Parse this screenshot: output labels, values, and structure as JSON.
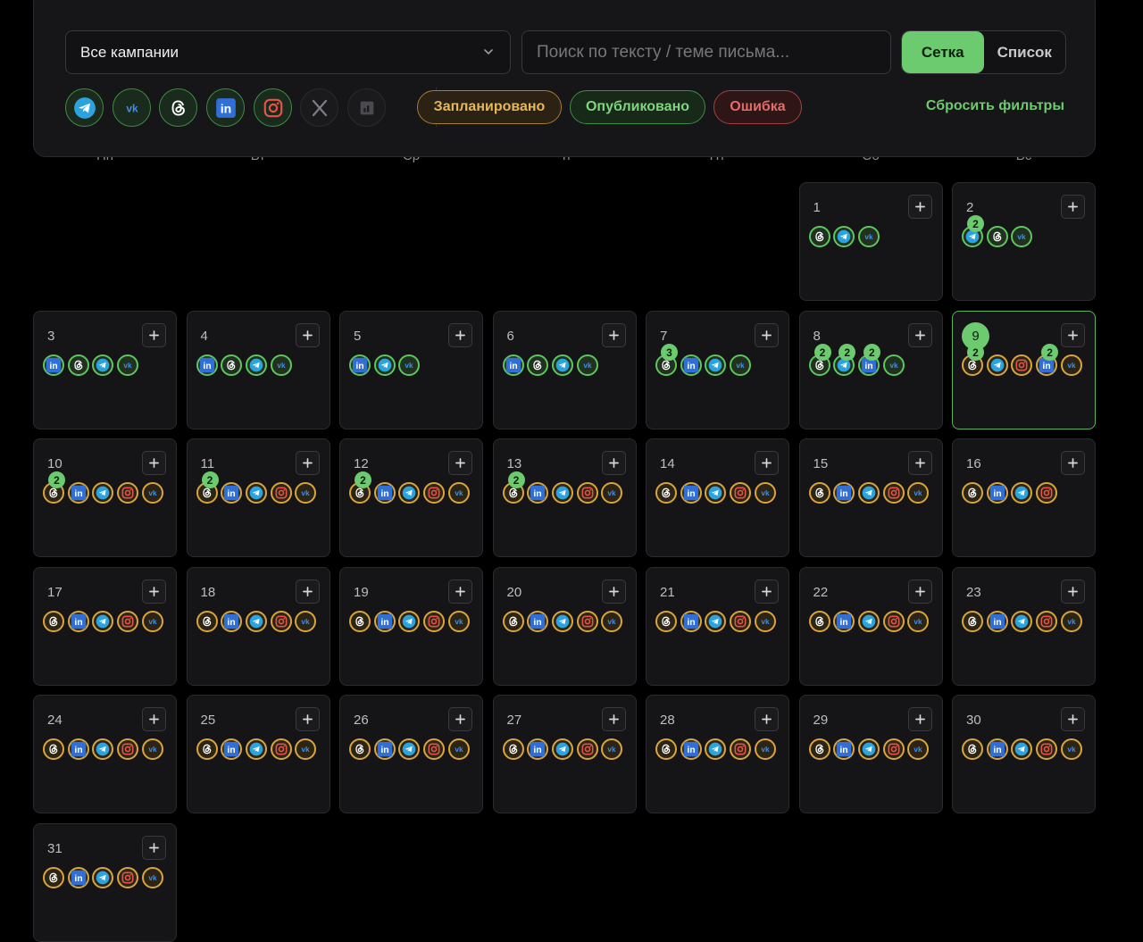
{
  "filters": {
    "campaign_select": "Все кампании",
    "search_placeholder": "Поиск по тексту / теме письма...",
    "view_grid": "Сетка",
    "view_list": "Список",
    "networks": [
      {
        "id": "telegram",
        "icon": "telegram-icon",
        "active": true
      },
      {
        "id": "vk",
        "icon": "vk-icon",
        "active": true
      },
      {
        "id": "threads",
        "icon": "threads-icon",
        "active": true
      },
      {
        "id": "linkedin",
        "icon": "linkedin-icon",
        "active": true
      },
      {
        "id": "instagram",
        "icon": "instagram-icon",
        "active": true
      },
      {
        "id": "x",
        "icon": "x-icon",
        "active": false
      },
      {
        "id": "other",
        "icon": "chart-icon",
        "active": false
      }
    ],
    "status_scheduled": "Запланировано",
    "status_published": "Опубликовано",
    "status_error": "Ошибка",
    "reset": "Сбросить фильтры"
  },
  "weekdays": [
    "Пн",
    "Вт",
    "Ср",
    "Чт",
    "Пт",
    "Сб",
    "Вс"
  ],
  "colors": {
    "published": "#5fc55f",
    "scheduled": "#d9a53d",
    "accent": "#6ccb6e"
  },
  "calendar": {
    "today": 9,
    "days": [
      {
        "d": 1,
        "posts": [
          {
            "n": "threads",
            "s": "g"
          },
          {
            "n": "telegram",
            "s": "g"
          },
          {
            "n": "vk",
            "s": "g"
          }
        ]
      },
      {
        "d": 2,
        "posts": [
          {
            "n": "telegram",
            "s": "g",
            "c": 2
          },
          {
            "n": "threads",
            "s": "g"
          },
          {
            "n": "vk",
            "s": "g"
          }
        ]
      },
      {
        "d": 3,
        "posts": [
          {
            "n": "linkedin",
            "s": "g"
          },
          {
            "n": "threads",
            "s": "g"
          },
          {
            "n": "telegram",
            "s": "g"
          },
          {
            "n": "vk",
            "s": "g"
          }
        ]
      },
      {
        "d": 4,
        "posts": [
          {
            "n": "linkedin",
            "s": "g"
          },
          {
            "n": "threads",
            "s": "g"
          },
          {
            "n": "telegram",
            "s": "g"
          },
          {
            "n": "vk",
            "s": "g"
          }
        ]
      },
      {
        "d": 5,
        "posts": [
          {
            "n": "linkedin",
            "s": "g"
          },
          {
            "n": "telegram",
            "s": "g"
          },
          {
            "n": "vk",
            "s": "g"
          }
        ]
      },
      {
        "d": 6,
        "posts": [
          {
            "n": "linkedin",
            "s": "g"
          },
          {
            "n": "threads",
            "s": "g"
          },
          {
            "n": "telegram",
            "s": "g"
          },
          {
            "n": "vk",
            "s": "g"
          }
        ]
      },
      {
        "d": 7,
        "posts": [
          {
            "n": "threads",
            "s": "g",
            "c": 3
          },
          {
            "n": "linkedin",
            "s": "g"
          },
          {
            "n": "telegram",
            "s": "g"
          },
          {
            "n": "vk",
            "s": "g"
          }
        ]
      },
      {
        "d": 8,
        "posts": [
          {
            "n": "threads",
            "s": "g",
            "c": 2
          },
          {
            "n": "telegram",
            "s": "g",
            "c": 2
          },
          {
            "n": "linkedin",
            "s": "g",
            "c": 2
          },
          {
            "n": "vk",
            "s": "g"
          }
        ]
      },
      {
        "d": 9,
        "posts": [
          {
            "n": "threads",
            "s": "o",
            "c": 2
          },
          {
            "n": "telegram",
            "s": "o"
          },
          {
            "n": "instagram",
            "s": "o"
          },
          {
            "n": "linkedin",
            "s": "o",
            "c": 2
          },
          {
            "n": "vk",
            "s": "o"
          }
        ]
      },
      {
        "d": 10,
        "posts": [
          {
            "n": "threads",
            "s": "o",
            "c": 2
          },
          {
            "n": "linkedin",
            "s": "o"
          },
          {
            "n": "telegram",
            "s": "o"
          },
          {
            "n": "instagram",
            "s": "o"
          },
          {
            "n": "vk",
            "s": "o"
          }
        ]
      },
      {
        "d": 11,
        "posts": [
          {
            "n": "threads",
            "s": "o",
            "c": 2
          },
          {
            "n": "linkedin",
            "s": "o"
          },
          {
            "n": "telegram",
            "s": "o"
          },
          {
            "n": "instagram",
            "s": "o"
          },
          {
            "n": "vk",
            "s": "o"
          }
        ]
      },
      {
        "d": 12,
        "posts": [
          {
            "n": "threads",
            "s": "o",
            "c": 2
          },
          {
            "n": "linkedin",
            "s": "o"
          },
          {
            "n": "telegram",
            "s": "o"
          },
          {
            "n": "instagram",
            "s": "o"
          },
          {
            "n": "vk",
            "s": "o"
          }
        ]
      },
      {
        "d": 13,
        "posts": [
          {
            "n": "threads",
            "s": "o",
            "c": 2
          },
          {
            "n": "linkedin",
            "s": "o"
          },
          {
            "n": "telegram",
            "s": "o"
          },
          {
            "n": "instagram",
            "s": "o"
          },
          {
            "n": "vk",
            "s": "o"
          }
        ]
      },
      {
        "d": 14,
        "posts": [
          {
            "n": "threads",
            "s": "o"
          },
          {
            "n": "linkedin",
            "s": "o"
          },
          {
            "n": "telegram",
            "s": "o"
          },
          {
            "n": "instagram",
            "s": "o"
          },
          {
            "n": "vk",
            "s": "o"
          }
        ]
      },
      {
        "d": 15,
        "posts": [
          {
            "n": "threads",
            "s": "o"
          },
          {
            "n": "linkedin",
            "s": "o"
          },
          {
            "n": "telegram",
            "s": "o"
          },
          {
            "n": "instagram",
            "s": "o"
          },
          {
            "n": "vk",
            "s": "o"
          }
        ]
      },
      {
        "d": 16,
        "posts": [
          {
            "n": "threads",
            "s": "o"
          },
          {
            "n": "linkedin",
            "s": "o"
          },
          {
            "n": "telegram",
            "s": "o"
          },
          {
            "n": "instagram",
            "s": "o"
          }
        ]
      },
      {
        "d": 17,
        "posts": [
          {
            "n": "threads",
            "s": "o"
          },
          {
            "n": "linkedin",
            "s": "o"
          },
          {
            "n": "telegram",
            "s": "o"
          },
          {
            "n": "instagram",
            "s": "o"
          },
          {
            "n": "vk",
            "s": "o"
          }
        ]
      },
      {
        "d": 18,
        "posts": [
          {
            "n": "threads",
            "s": "o"
          },
          {
            "n": "linkedin",
            "s": "o"
          },
          {
            "n": "telegram",
            "s": "o"
          },
          {
            "n": "instagram",
            "s": "o"
          },
          {
            "n": "vk",
            "s": "o"
          }
        ]
      },
      {
        "d": 19,
        "posts": [
          {
            "n": "threads",
            "s": "o"
          },
          {
            "n": "linkedin",
            "s": "o"
          },
          {
            "n": "telegram",
            "s": "o"
          },
          {
            "n": "instagram",
            "s": "o"
          },
          {
            "n": "vk",
            "s": "o"
          }
        ]
      },
      {
        "d": 20,
        "posts": [
          {
            "n": "threads",
            "s": "o"
          },
          {
            "n": "linkedin",
            "s": "o"
          },
          {
            "n": "telegram",
            "s": "o"
          },
          {
            "n": "instagram",
            "s": "o"
          },
          {
            "n": "vk",
            "s": "o"
          }
        ]
      },
      {
        "d": 21,
        "posts": [
          {
            "n": "threads",
            "s": "o"
          },
          {
            "n": "linkedin",
            "s": "o"
          },
          {
            "n": "telegram",
            "s": "o"
          },
          {
            "n": "instagram",
            "s": "o"
          },
          {
            "n": "vk",
            "s": "o"
          }
        ]
      },
      {
        "d": 22,
        "posts": [
          {
            "n": "threads",
            "s": "o"
          },
          {
            "n": "linkedin",
            "s": "o"
          },
          {
            "n": "telegram",
            "s": "o"
          },
          {
            "n": "instagram",
            "s": "o"
          },
          {
            "n": "vk",
            "s": "o"
          }
        ]
      },
      {
        "d": 23,
        "posts": [
          {
            "n": "threads",
            "s": "o"
          },
          {
            "n": "linkedin",
            "s": "o"
          },
          {
            "n": "telegram",
            "s": "o"
          },
          {
            "n": "instagram",
            "s": "o"
          },
          {
            "n": "vk",
            "s": "o"
          }
        ]
      },
      {
        "d": 24,
        "posts": [
          {
            "n": "threads",
            "s": "o"
          },
          {
            "n": "linkedin",
            "s": "o"
          },
          {
            "n": "telegram",
            "s": "o"
          },
          {
            "n": "instagram",
            "s": "o"
          },
          {
            "n": "vk",
            "s": "o"
          }
        ]
      },
      {
        "d": 25,
        "posts": [
          {
            "n": "threads",
            "s": "o"
          },
          {
            "n": "linkedin",
            "s": "o"
          },
          {
            "n": "telegram",
            "s": "o"
          },
          {
            "n": "instagram",
            "s": "o"
          },
          {
            "n": "vk",
            "s": "o"
          }
        ]
      },
      {
        "d": 26,
        "posts": [
          {
            "n": "threads",
            "s": "o"
          },
          {
            "n": "linkedin",
            "s": "o"
          },
          {
            "n": "telegram",
            "s": "o"
          },
          {
            "n": "instagram",
            "s": "o"
          },
          {
            "n": "vk",
            "s": "o"
          }
        ]
      },
      {
        "d": 27,
        "posts": [
          {
            "n": "threads",
            "s": "o"
          },
          {
            "n": "linkedin",
            "s": "o"
          },
          {
            "n": "telegram",
            "s": "o"
          },
          {
            "n": "instagram",
            "s": "o"
          },
          {
            "n": "vk",
            "s": "o"
          }
        ]
      },
      {
        "d": 28,
        "posts": [
          {
            "n": "threads",
            "s": "o"
          },
          {
            "n": "linkedin",
            "s": "o"
          },
          {
            "n": "telegram",
            "s": "o"
          },
          {
            "n": "instagram",
            "s": "o"
          },
          {
            "n": "vk",
            "s": "o"
          }
        ]
      },
      {
        "d": 29,
        "posts": [
          {
            "n": "threads",
            "s": "o"
          },
          {
            "n": "linkedin",
            "s": "o"
          },
          {
            "n": "telegram",
            "s": "o"
          },
          {
            "n": "instagram",
            "s": "o"
          },
          {
            "n": "vk",
            "s": "o"
          }
        ]
      },
      {
        "d": 30,
        "posts": [
          {
            "n": "threads",
            "s": "o"
          },
          {
            "n": "linkedin",
            "s": "o"
          },
          {
            "n": "telegram",
            "s": "o"
          },
          {
            "n": "instagram",
            "s": "o"
          },
          {
            "n": "vk",
            "s": "o"
          }
        ]
      },
      {
        "d": 31,
        "posts": [
          {
            "n": "threads",
            "s": "o"
          },
          {
            "n": "linkedin",
            "s": "o"
          },
          {
            "n": "telegram",
            "s": "o"
          },
          {
            "n": "instagram",
            "s": "o"
          },
          {
            "n": "vk",
            "s": "o"
          }
        ]
      }
    ]
  }
}
